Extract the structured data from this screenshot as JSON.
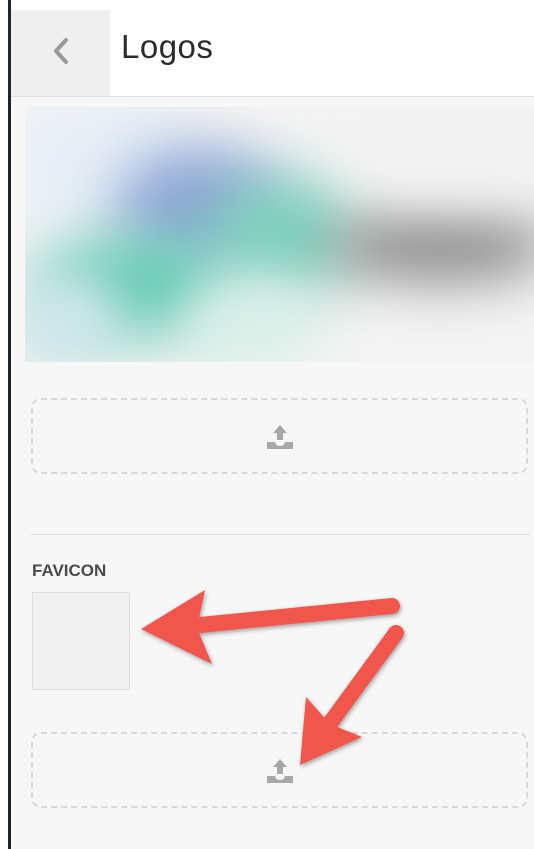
{
  "header": {
    "title": "Logos",
    "back_icon": "chevron-left-icon"
  },
  "logo_section": {
    "preview": "blurred-logo-image",
    "upload_icon": "upload-icon"
  },
  "favicon_section": {
    "label": "FAVICON",
    "preview": "empty-favicon-placeholder",
    "upload_icon": "upload-icon"
  },
  "annotations": {
    "arrows": [
      "arrow-to-favicon-preview",
      "arrow-to-favicon-upload"
    ],
    "arrow_color": "#f0564b"
  },
  "colors": {
    "panel_bg": "#f7f7f7",
    "header_bg": "#ffffff",
    "back_button_bg": "#efefef",
    "dashed_border": "#d9d9d9",
    "icon_gray": "#a8a8a8"
  }
}
